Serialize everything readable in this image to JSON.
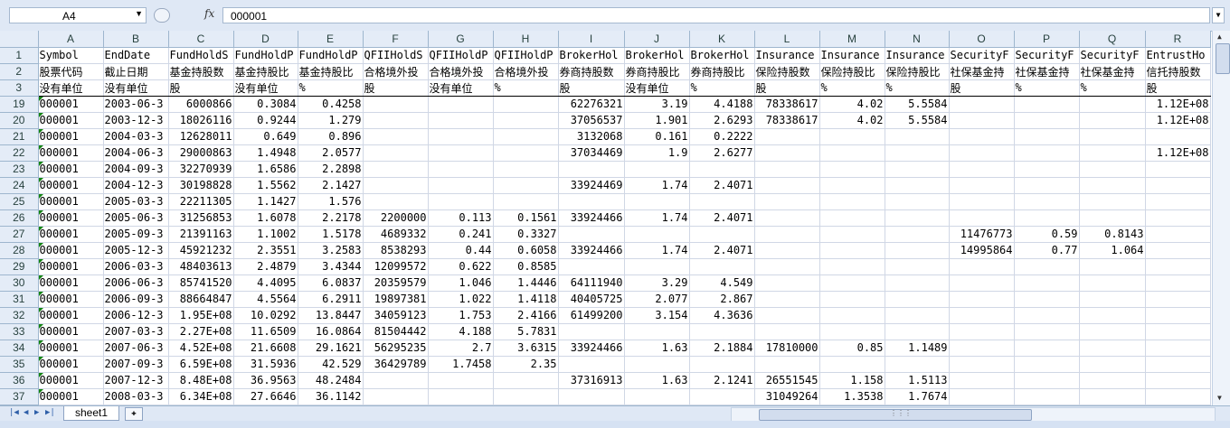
{
  "formula_bar": {
    "name_box": "A4",
    "fx_label": "fx",
    "formula_value": "000001"
  },
  "columns": [
    "A",
    "B",
    "C",
    "D",
    "E",
    "F",
    "G",
    "H",
    "I",
    "J",
    "K",
    "L",
    "M",
    "N",
    "O",
    "P",
    "Q",
    "R"
  ],
  "header_rows": [
    {
      "row": "1",
      "cells": [
        "Symbol",
        "EndDate",
        "FundHoldS",
        "FundHoldP",
        "FundHoldP",
        "QFIIHoldS",
        "QFIIHoldP",
        "QFIIHoldP",
        "BrokerHol",
        "BrokerHol",
        "BrokerHol",
        "Insurance",
        "Insurance",
        "Insurance",
        "SecurityF",
        "SecurityF",
        "SecurityF",
        "EntrustHo"
      ]
    },
    {
      "row": "2",
      "cells": [
        "股票代码",
        "截止日期",
        "基金持股数",
        "基金持股比",
        "基金持股比",
        "合格境外投",
        "合格境外投",
        "合格境外投",
        "券商持股数",
        "券商持股比",
        "券商持股比",
        "保险持股数",
        "保险持股比",
        "保险持股比",
        "社保基金持",
        "社保基金持",
        "社保基金持",
        "信托持股数"
      ]
    },
    {
      "row": "3",
      "cells": [
        "没有单位",
        "没有单位",
        "股",
        "没有单位",
        "%",
        "股",
        "没有单位",
        "%",
        "股",
        "没有单位",
        "%",
        "股",
        "%",
        "%",
        "股",
        "%",
        "%",
        "股"
      ]
    }
  ],
  "rows": [
    {
      "row": "19",
      "cells": [
        "000001",
        "2003-06-3",
        "6000866",
        "0.3084",
        "0.4258",
        "",
        "",
        "",
        "62276321",
        "3.19",
        "4.4188",
        "78338617",
        "4.02",
        "5.5584",
        "",
        "",
        "",
        "1.12E+08"
      ]
    },
    {
      "row": "20",
      "cells": [
        "000001",
        "2003-12-3",
        "18026116",
        "0.9244",
        "1.279",
        "",
        "",
        "",
        "37056537",
        "1.901",
        "2.6293",
        "78338617",
        "4.02",
        "5.5584",
        "",
        "",
        "",
        "1.12E+08"
      ]
    },
    {
      "row": "21",
      "cells": [
        "000001",
        "2004-03-3",
        "12628011",
        "0.649",
        "0.896",
        "",
        "",
        "",
        "3132068",
        "0.161",
        "0.2222",
        "",
        "",
        "",
        "",
        "",
        "",
        ""
      ]
    },
    {
      "row": "22",
      "cells": [
        "000001",
        "2004-06-3",
        "29000863",
        "1.4948",
        "2.0577",
        "",
        "",
        "",
        "37034469",
        "1.9",
        "2.6277",
        "",
        "",
        "",
        "",
        "",
        "",
        "1.12E+08"
      ]
    },
    {
      "row": "23",
      "cells": [
        "000001",
        "2004-09-3",
        "32270939",
        "1.6586",
        "2.2898",
        "",
        "",
        "",
        "",
        "",
        "",
        "",
        "",
        "",
        "",
        "",
        "",
        ""
      ]
    },
    {
      "row": "24",
      "cells": [
        "000001",
        "2004-12-3",
        "30198828",
        "1.5562",
        "2.1427",
        "",
        "",
        "",
        "33924469",
        "1.74",
        "2.4071",
        "",
        "",
        "",
        "",
        "",
        "",
        ""
      ]
    },
    {
      "row": "25",
      "cells": [
        "000001",
        "2005-03-3",
        "22211305",
        "1.1427",
        "1.576",
        "",
        "",
        "",
        "",
        "",
        "",
        "",
        "",
        "",
        "",
        "",
        "",
        ""
      ]
    },
    {
      "row": "26",
      "cells": [
        "000001",
        "2005-06-3",
        "31256853",
        "1.6078",
        "2.2178",
        "2200000",
        "0.113",
        "0.1561",
        "33924466",
        "1.74",
        "2.4071",
        "",
        "",
        "",
        "",
        "",
        "",
        ""
      ]
    },
    {
      "row": "27",
      "cells": [
        "000001",
        "2005-09-3",
        "21391163",
        "1.1002",
        "1.5178",
        "4689332",
        "0.241",
        "0.3327",
        "",
        "",
        "",
        "",
        "",
        "",
        "11476773",
        "0.59",
        "0.8143",
        ""
      ]
    },
    {
      "row": "28",
      "cells": [
        "000001",
        "2005-12-3",
        "45921232",
        "2.3551",
        "3.2583",
        "8538293",
        "0.44",
        "0.6058",
        "33924466",
        "1.74",
        "2.4071",
        "",
        "",
        "",
        "14995864",
        "0.77",
        "1.064",
        ""
      ]
    },
    {
      "row": "29",
      "cells": [
        "000001",
        "2006-03-3",
        "48403613",
        "2.4879",
        "3.4344",
        "12099572",
        "0.622",
        "0.8585",
        "",
        "",
        "",
        "",
        "",
        "",
        "",
        "",
        "",
        ""
      ]
    },
    {
      "row": "30",
      "cells": [
        "000001",
        "2006-06-3",
        "85741520",
        "4.4095",
        "6.0837",
        "20359579",
        "1.046",
        "1.4446",
        "64111940",
        "3.29",
        "4.549",
        "",
        "",
        "",
        "",
        "",
        "",
        ""
      ]
    },
    {
      "row": "31",
      "cells": [
        "000001",
        "2006-09-3",
        "88664847",
        "4.5564",
        "6.2911",
        "19897381",
        "1.022",
        "1.4118",
        "40405725",
        "2.077",
        "2.867",
        "",
        "",
        "",
        "",
        "",
        "",
        ""
      ]
    },
    {
      "row": "32",
      "cells": [
        "000001",
        "2006-12-3",
        "1.95E+08",
        "10.0292",
        "13.8447",
        "34059123",
        "1.753",
        "2.4166",
        "61499200",
        "3.154",
        "4.3636",
        "",
        "",
        "",
        "",
        "",
        "",
        ""
      ]
    },
    {
      "row": "33",
      "cells": [
        "000001",
        "2007-03-3",
        "2.27E+08",
        "11.6509",
        "16.0864",
        "81504442",
        "4.188",
        "5.7831",
        "",
        "",
        "",
        "",
        "",
        "",
        "",
        "",
        "",
        ""
      ]
    },
    {
      "row": "34",
      "cells": [
        "000001",
        "2007-06-3",
        "4.52E+08",
        "21.6608",
        "29.1621",
        "56295235",
        "2.7",
        "3.6315",
        "33924466",
        "1.63",
        "2.1884",
        "17810000",
        "0.85",
        "1.1489",
        "",
        "",
        "",
        ""
      ]
    },
    {
      "row": "35",
      "cells": [
        "000001",
        "2007-09-3",
        "6.59E+08",
        "31.5936",
        "42.529",
        "36429789",
        "1.7458",
        "2.35",
        "",
        "",
        "",
        "",
        "",
        "",
        "",
        "",
        "",
        ""
      ]
    },
    {
      "row": "36",
      "cells": [
        "000001",
        "2007-12-3",
        "8.48E+08",
        "36.9563",
        "48.2484",
        "",
        "",
        "",
        "37316913",
        "1.63",
        "2.1241",
        "26551545",
        "1.158",
        "1.5113",
        "",
        "",
        "",
        ""
      ]
    },
    {
      "row": "37",
      "cells": [
        "000001",
        "2008-03-3",
        "6.34E+08",
        "27.6646",
        "36.1142",
        "",
        "",
        "",
        "",
        "",
        "",
        "31049264",
        "1.3538",
        "1.7674",
        "",
        "",
        "",
        ""
      ]
    }
  ],
  "sheet_tabs": [
    "sheet1"
  ],
  "scroll": {
    "up_arrow": "▲",
    "down_arrow": "▼",
    "left_arrow": "◀",
    "right_arrow": "▶"
  },
  "colors": {
    "header_bg": "#e4ecf7",
    "gridline": "#d0d7e5",
    "chrome": "#dfe8f5",
    "accent": "#f48a1a"
  }
}
